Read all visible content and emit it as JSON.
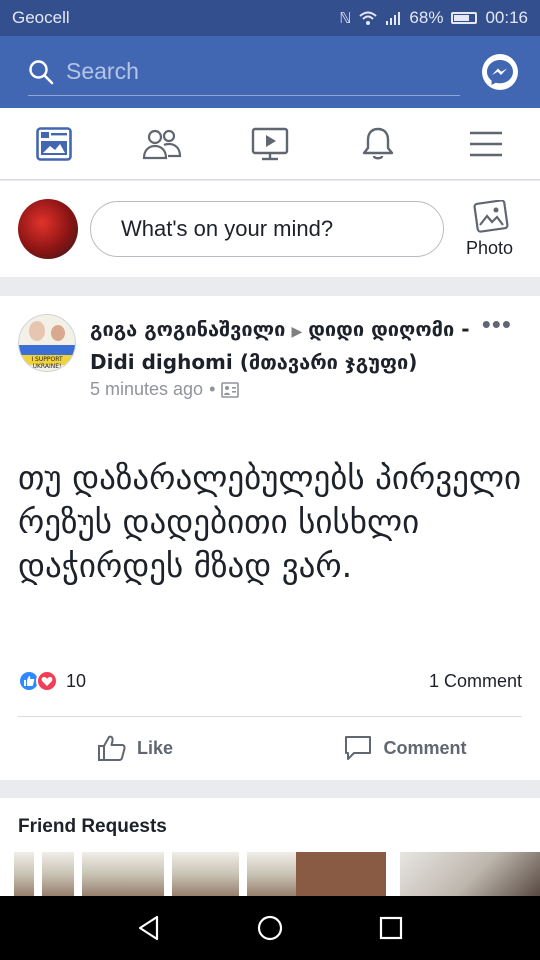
{
  "status_bar": {
    "carrier": "Geocell",
    "battery": "68%",
    "time": "00:16",
    "battery_level": 0.68,
    "icons": [
      "nfc-icon",
      "wifi-icon",
      "signal-icon",
      "battery-icon"
    ]
  },
  "search": {
    "placeholder": "Search",
    "icon": "search-icon",
    "messenger_icon": "messenger-icon"
  },
  "nav_tabs": [
    {
      "name": "news-feed",
      "icon": "news-feed-icon",
      "active": true
    },
    {
      "name": "friends",
      "icon": "friends-icon"
    },
    {
      "name": "watch",
      "icon": "video-icon"
    },
    {
      "name": "notifications",
      "icon": "bell-icon"
    },
    {
      "name": "menu",
      "icon": "hamburger-menu-icon"
    }
  ],
  "composer": {
    "prompt": "What's on your mind?",
    "photo_label": "Photo"
  },
  "post": {
    "author": "გიგა გოგინაშვილი",
    "group": "დიდი დიღომი - Didi dighomi (მთავარი ჯგუფი)",
    "time": "5 minutes ago",
    "separator": "•",
    "avatar_text": "I SUPPORT UKRAINE!",
    "body": "თუ დაზარალებულებს პირველი რეზუს დადებითი სისხლი დაჭირდეს მზად ვარ.",
    "reaction_count": "10",
    "comment_count": "1 Comment",
    "like_label": "Like",
    "comment_label": "Comment"
  },
  "friend_requests": {
    "title": "Friend Requests"
  },
  "colors": {
    "brand_blue": "#4267b2",
    "status_bar": "#334f8d",
    "like_blue": "#2e89ff",
    "love_red": "#f33e58"
  }
}
